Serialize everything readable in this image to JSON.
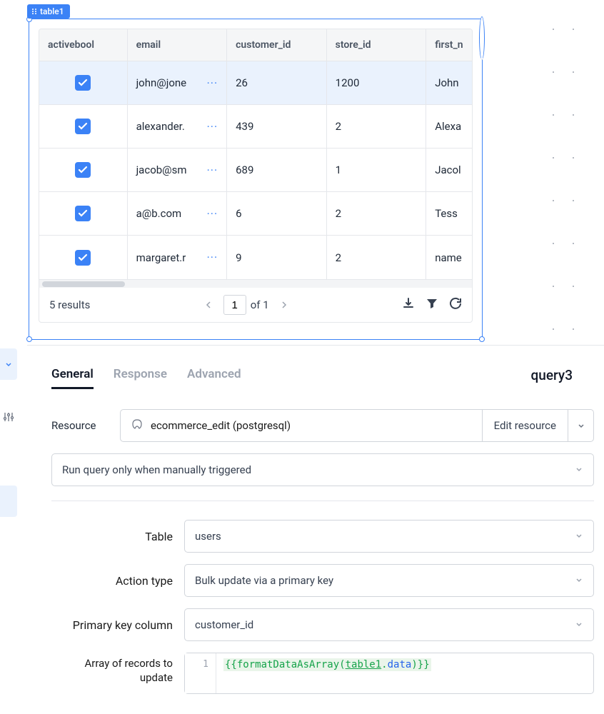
{
  "component": {
    "badge": "table1"
  },
  "table": {
    "columns": [
      "activebool",
      "email",
      "customer_id",
      "store_id",
      "first_n"
    ],
    "rows": [
      {
        "active": true,
        "email": "john@jone",
        "customer_id": "26",
        "store_id": "1200",
        "first": "John",
        "selected": true
      },
      {
        "active": true,
        "email": "alexander.",
        "customer_id": "439",
        "store_id": "2",
        "first": "Alexa",
        "selected": false
      },
      {
        "active": true,
        "email": "jacob@sm",
        "customer_id": "689",
        "store_id": "1",
        "first": "Jacol",
        "selected": false
      },
      {
        "active": true,
        "email": "a@b.com",
        "customer_id": "6",
        "store_id": "2",
        "first": "Tess",
        "selected": false
      },
      {
        "active": true,
        "email": "margaret.r",
        "customer_id": "9",
        "store_id": "2",
        "first": "name",
        "selected": false
      }
    ],
    "results_text": "5 results",
    "page_current": "1",
    "page_of": "of 1"
  },
  "tabs": {
    "general": "General",
    "response": "Response",
    "advanced": "Advanced"
  },
  "query_name": "query3",
  "form": {
    "resource_label": "Resource",
    "resource_value": "ecommerce_edit (postgresql)",
    "edit_resource": "Edit resource",
    "trigger_mode": "Run query only when manually triggered",
    "table_label": "Table",
    "table_value": "users",
    "action_label": "Action type",
    "action_value": "Bulk update via a primary key",
    "pk_label": "Primary key column",
    "pk_value": "customer_id",
    "records_label": "Array of records to update",
    "code_line_no": "1",
    "code": {
      "open": "{{",
      "fn": "formatDataAsArray",
      "lp": "(",
      "ref": "table1",
      "dot": ".",
      "prop": "data",
      "rp": ")",
      "close": "}}"
    }
  }
}
